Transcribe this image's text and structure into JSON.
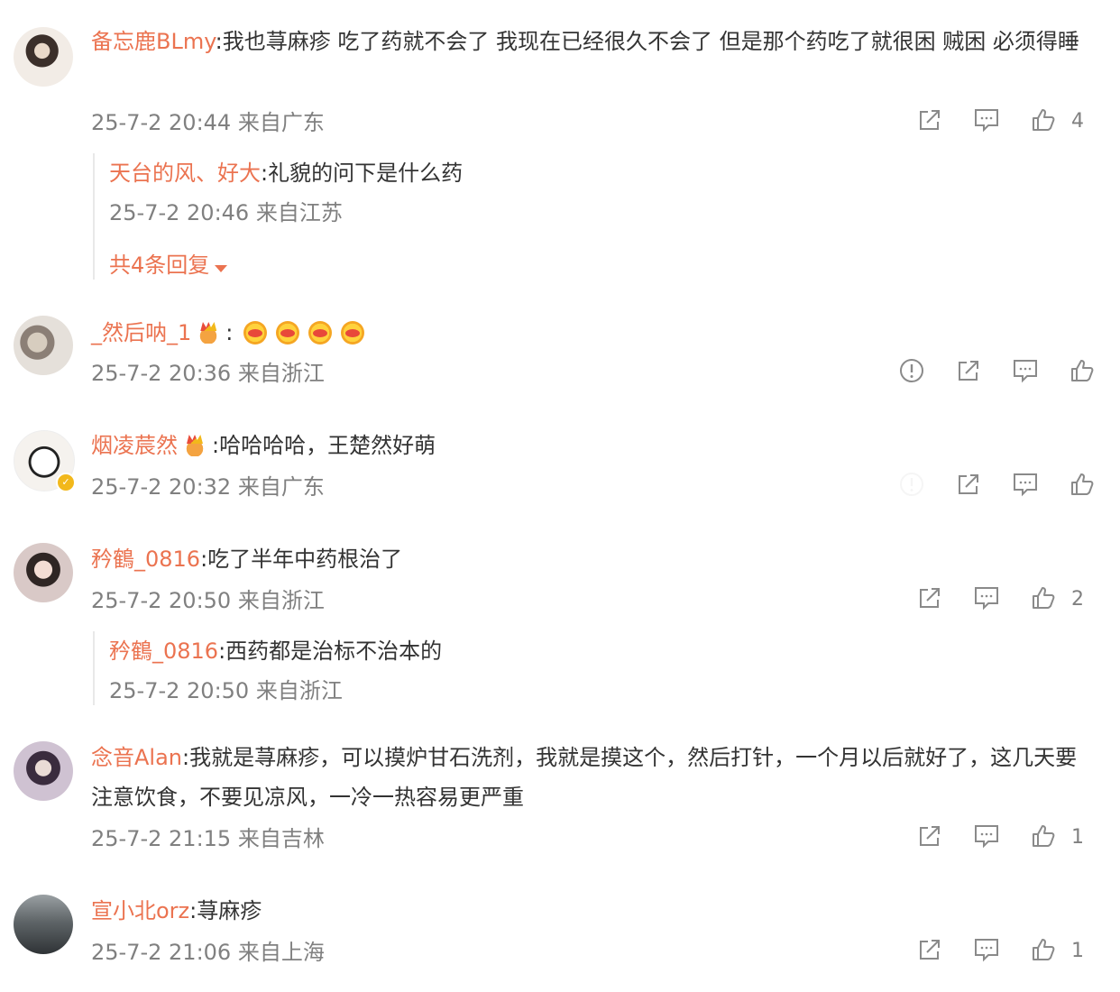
{
  "comments": [
    {
      "user": "备忘鹿BLmy",
      "text": ":我也荨麻疹 吃了药就不会了 我现在已经很久不会了 但是那个药吃了就很困 贼困 必须得睡",
      "time": "25-7-2 20:44 来自广东",
      "likes": "4",
      "replies": [
        {
          "user": "天台的风、好大",
          "text": ":礼貌的问下是什么药",
          "time": "25-7-2 20:46 来自江苏"
        }
      ],
      "more_replies": "共4条回复"
    },
    {
      "user": "_然后呐_1",
      "text": ":",
      "emoji_count": 4,
      "time": "25-7-2 20:36 来自浙江",
      "likes": ""
    },
    {
      "user": "烟凌莀然",
      "text": ":哈哈哈哈，王楚然好萌",
      "time": "25-7-2 20:32 来自广东",
      "likes": ""
    },
    {
      "user": "矜鶴_0816",
      "text": ":吃了半年中药根治了",
      "time": "25-7-2 20:50 来自浙江",
      "likes": "2",
      "replies": [
        {
          "user": "矜鶴_0816",
          "text": ":西药都是治标不治本的",
          "time": "25-7-2 20:50 来自浙江"
        }
      ]
    },
    {
      "user": "念音Alan",
      "text": ":我就是荨麻疹，可以摸炉甘石洗剂，我就是摸这个，然后打针，一个月以后就好了，这几天要注意饮食，不要见凉风，一冷一热容易更严重",
      "time": "25-7-2 21:15 来自吉林",
      "likes": "1"
    },
    {
      "user": "宣小北orz",
      "text": ":荨麻疹",
      "time": "25-7-2 21:06 来自上海",
      "likes": "1"
    }
  ],
  "icons": {
    "share": "share-icon",
    "comment": "comment-icon",
    "like": "thumbs-up-icon",
    "report": "report-icon",
    "verified": "verified-badge-icon",
    "expand": "caret-down-icon"
  },
  "colors": {
    "username": "#eb7350",
    "meta": "#808080",
    "text": "#333333"
  }
}
